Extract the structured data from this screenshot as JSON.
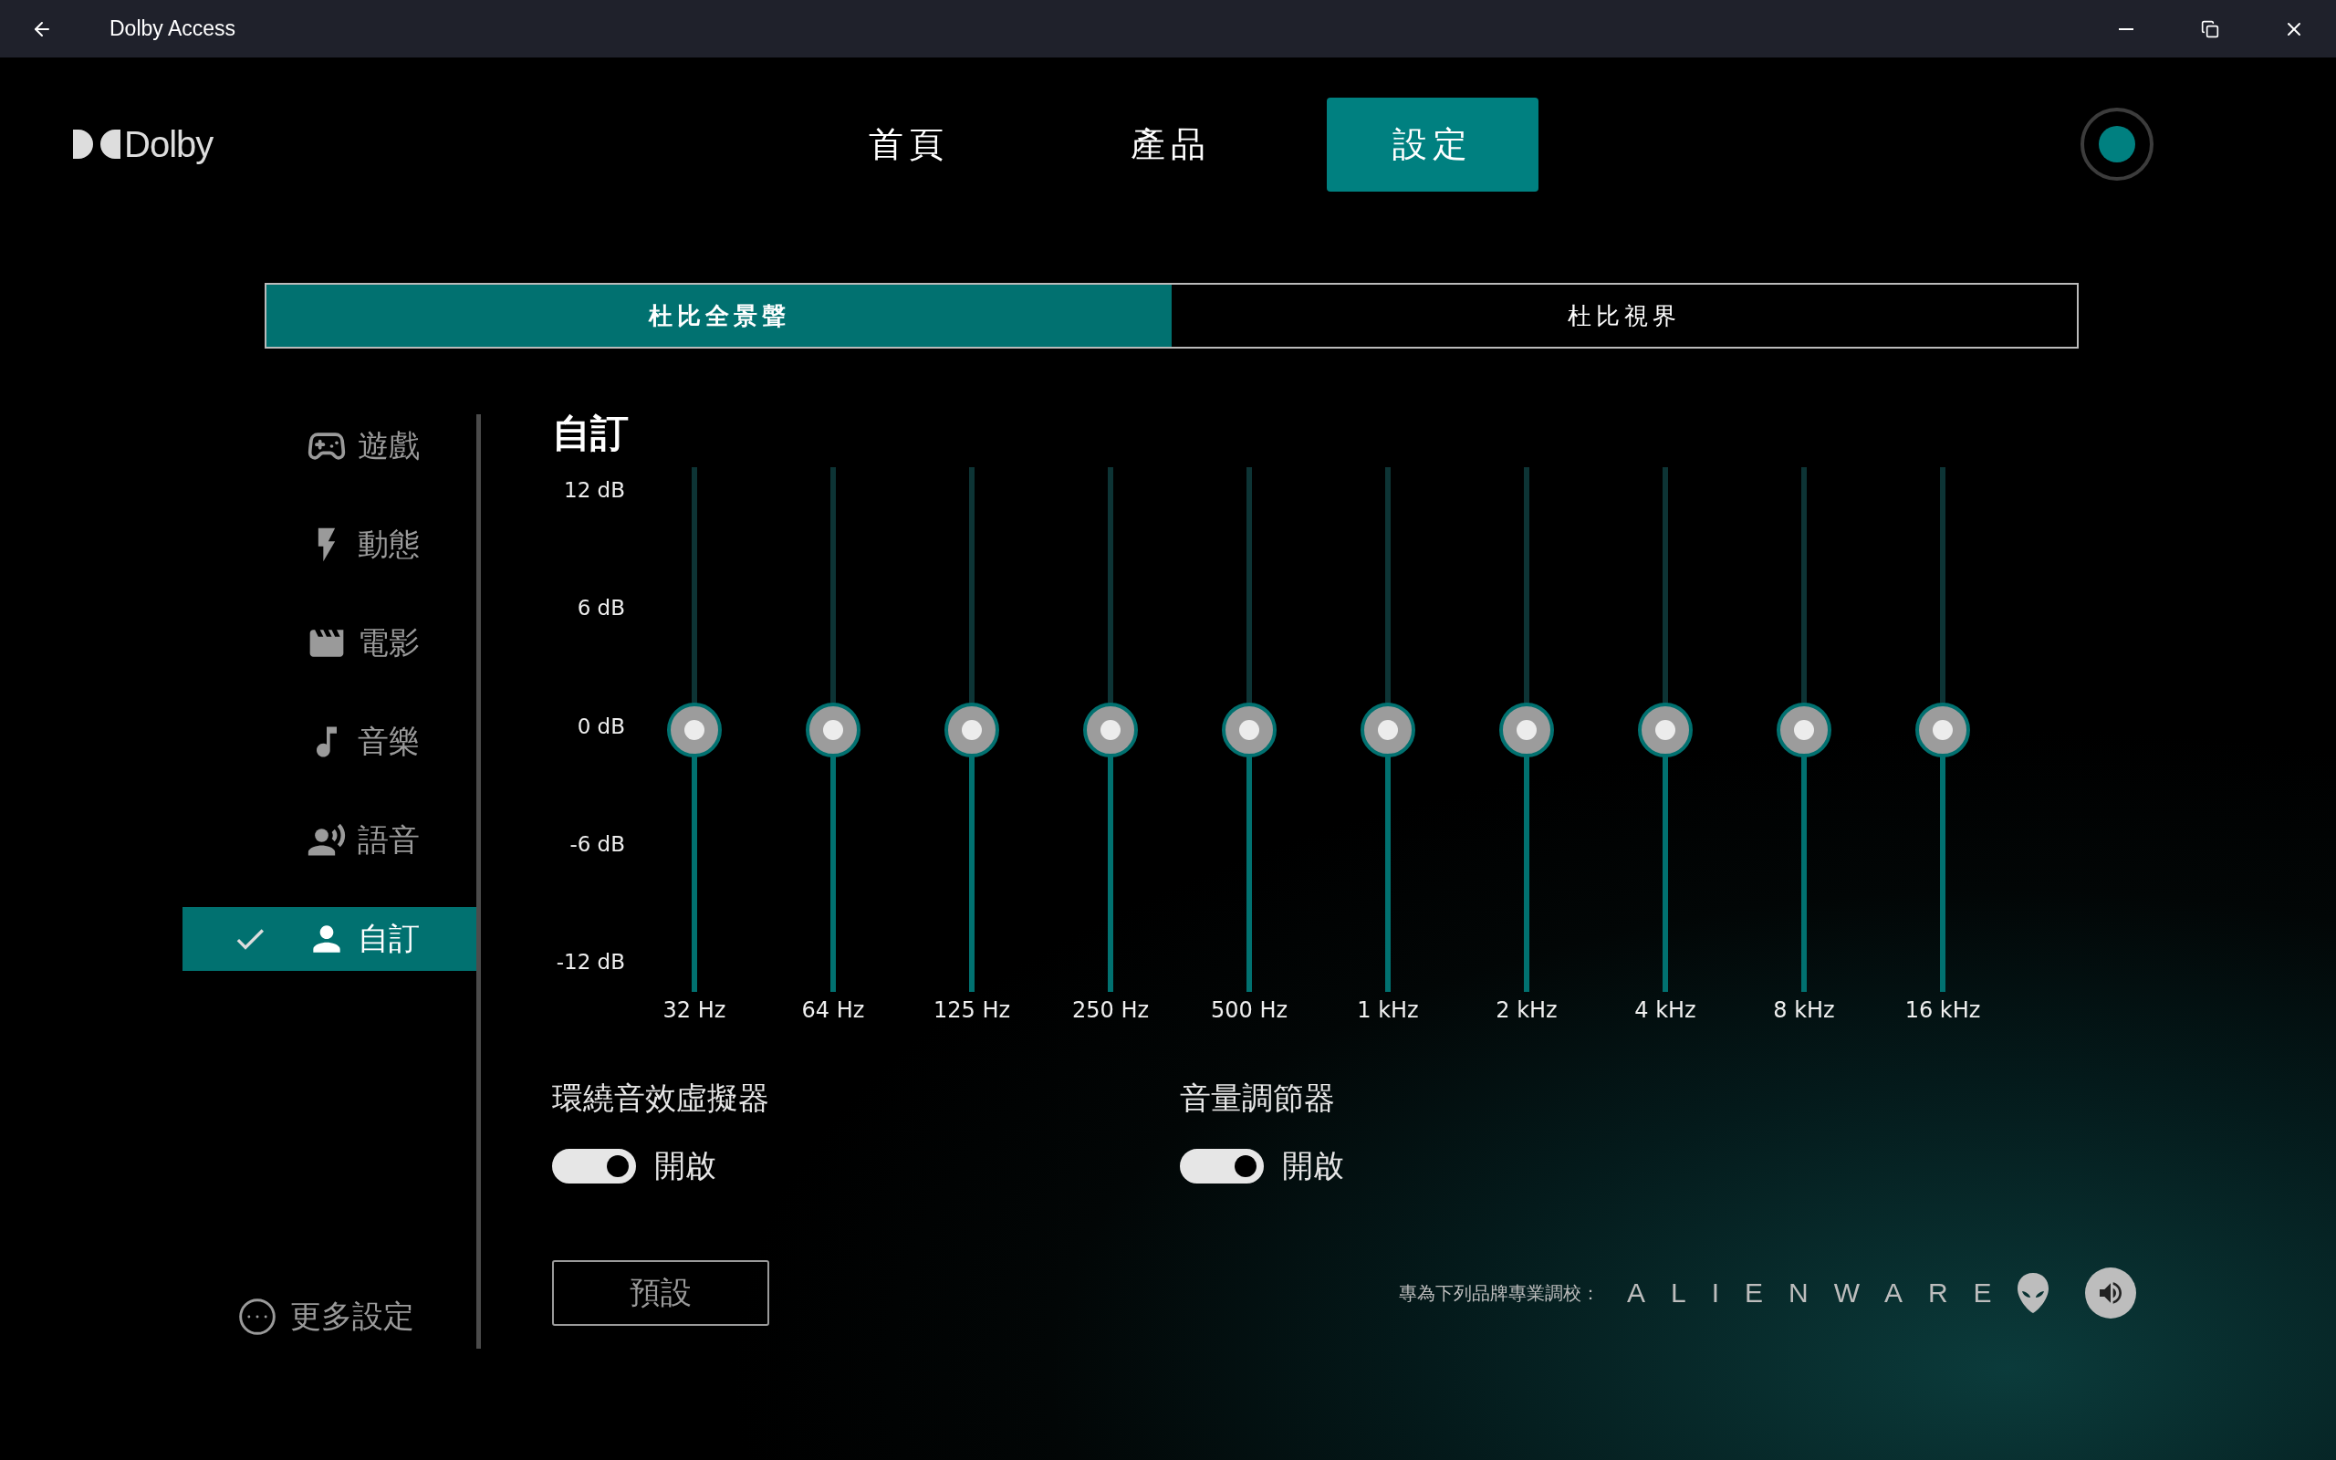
{
  "window": {
    "title": "Dolby Access"
  },
  "logo": {
    "text": "Dolby"
  },
  "nav": [
    {
      "label": "首頁",
      "selected": false
    },
    {
      "label": "產品",
      "selected": false
    },
    {
      "label": "設定",
      "selected": true
    }
  ],
  "sub_tabs": [
    {
      "label": "杜比全景聲",
      "selected": true
    },
    {
      "label": "杜比視界",
      "selected": false
    }
  ],
  "profiles": [
    {
      "kind": "game",
      "label": "遊戲",
      "selected": false
    },
    {
      "kind": "dynamic",
      "label": "動態",
      "selected": false
    },
    {
      "kind": "movie",
      "label": "電影",
      "selected": false
    },
    {
      "kind": "music",
      "label": "音樂",
      "selected": false
    },
    {
      "kind": "voice",
      "label": "語音",
      "selected": false
    },
    {
      "kind": "custom",
      "label": "自訂",
      "selected": true
    }
  ],
  "more_settings": "更多設定",
  "equalizer": {
    "title": "自訂",
    "scale": [
      "12 dB",
      "6 dB",
      "0 dB",
      "-6 dB",
      "-12 dB"
    ],
    "bands": [
      {
        "label": "32 Hz",
        "level": 0.5
      },
      {
        "label": "64 Hz",
        "level": 0.5
      },
      {
        "label": "125 Hz",
        "level": 0.5
      },
      {
        "label": "250 Hz",
        "level": 0.5
      },
      {
        "label": "500 Hz",
        "level": 0.5
      },
      {
        "label": "1 kHz",
        "level": 0.5
      },
      {
        "label": "2 kHz",
        "level": 0.5
      },
      {
        "label": "4 kHz",
        "level": 0.5
      },
      {
        "label": "8 kHz",
        "level": 0.5
      },
      {
        "label": "16 kHz",
        "level": 0.5
      }
    ]
  },
  "switches": [
    {
      "title": "環繞音效虛擬器",
      "on": true,
      "state_label": "開啟"
    },
    {
      "title": "音量調節器",
      "on": true,
      "state_label": "開啟"
    }
  ],
  "reset_button": "預設",
  "footer": {
    "tuned_for": "專為下列品牌專業調校：",
    "brand": "ALIENWARE"
  }
}
